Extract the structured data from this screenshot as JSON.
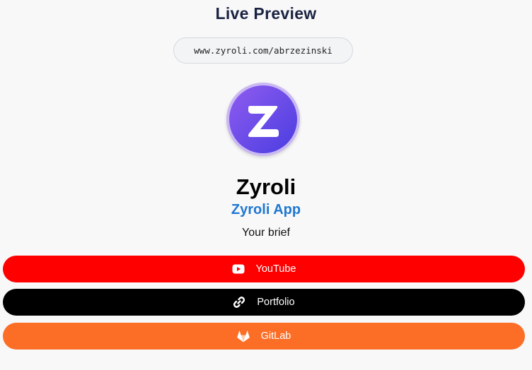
{
  "header": {
    "title": "Live Preview"
  },
  "profile": {
    "url": "www.zyroli.com/abrzezinski",
    "name": "Zyroli",
    "subtitle": "Zyroli App",
    "brief": "Your brief",
    "avatar_icon": "zyroli-logo-icon",
    "avatar_letter": "Z"
  },
  "links": [
    {
      "label": "YouTube",
      "icon": "youtube-icon",
      "color": "#ff0000"
    },
    {
      "label": "Portfolio",
      "icon": "link-icon",
      "color": "#000000"
    },
    {
      "label": "GitLab",
      "icon": "gitlab-icon",
      "color": "#fc6d26"
    }
  ],
  "colors": {
    "title": "#1a2240",
    "subtitle": "#1f78d1",
    "avatar_gradient_start": "#8f5cf0",
    "avatar_gradient_end": "#4d3fe0"
  }
}
